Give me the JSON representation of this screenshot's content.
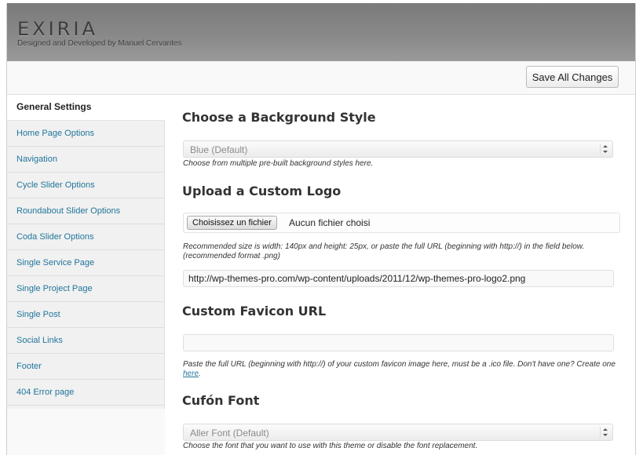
{
  "header": {
    "logo": "EXIRIA",
    "tagline": "Designed and Developed by Manuel Cervantes"
  },
  "toolbar": {
    "save_label": "Save All Changes"
  },
  "sidebar": {
    "items": [
      {
        "label": "General Settings",
        "active": true
      },
      {
        "label": "Home Page Options"
      },
      {
        "label": "Navigation"
      },
      {
        "label": "Cycle Slider Options"
      },
      {
        "label": "Roundabout Slider Options"
      },
      {
        "label": "Coda Slider Options"
      },
      {
        "label": "Single Service Page"
      },
      {
        "label": "Single Project Page"
      },
      {
        "label": "Single Post"
      },
      {
        "label": "Social Links"
      },
      {
        "label": "Footer"
      },
      {
        "label": "404 Error page"
      }
    ]
  },
  "main": {
    "background": {
      "title": "Choose a Background Style",
      "selected": "Blue (Default)",
      "description": "Choose from multiple pre-built background styles here."
    },
    "logo": {
      "title": "Upload a Custom Logo",
      "file_button": "Choisissez un fichier",
      "file_status": "Aucun fichier choisi",
      "description": "Recommended size is width: 140px and height: 25px, or paste the full URL (beginning with http://) in the field below. (recommended format .png)",
      "url_value": "http://wp-themes-pro.com/wp-content/uploads/2011/12/wp-themes-pro-logo2.png"
    },
    "favicon": {
      "title": "Custom Favicon URL",
      "value": "",
      "description_before": "Paste the full URL (beginning with http://) of your custom favicon image here, must be a .ico file. Don't have one? Create one ",
      "link_text": "here",
      "description_after": "."
    },
    "font": {
      "title": "Cufón Font",
      "selected": "Aller Font (Default)",
      "description": "Choose the font that you want to use with this theme or disable the font replacement."
    }
  },
  "colors": {
    "header_bg": "#858585",
    "link": "#21759b",
    "sidebar_bg": "#f1f1f1"
  }
}
